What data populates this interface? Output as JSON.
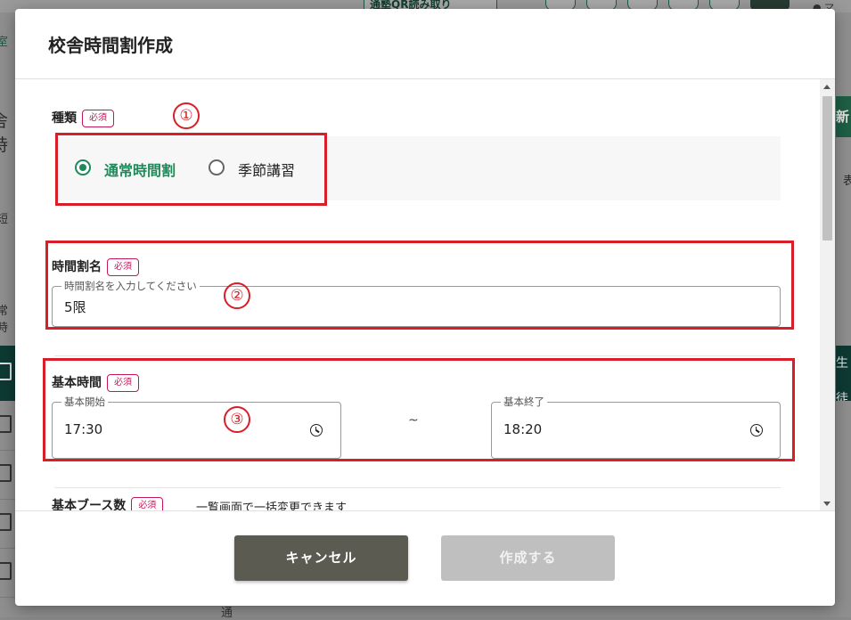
{
  "background": {
    "qr_button_label": "通塾QR読み取り",
    "user_label": "マ",
    "left_edge_texts": [
      "室",
      "舎時",
      "短",
      "常時"
    ],
    "right_edge_texts": [
      "新",
      "表",
      "生徒"
    ],
    "bottom_row_text": "通"
  },
  "modal": {
    "title": "校舎時間割作成",
    "required_label": "必須",
    "type_field": {
      "label": "種類",
      "options": [
        "通常時間割",
        "季節講習"
      ],
      "selected": "通常時間割"
    },
    "name_field": {
      "label": "時間割名",
      "placeholder": "時間割名を入力してください",
      "value": "5限"
    },
    "time_field": {
      "label": "基本時間",
      "start_label": "基本開始",
      "start_value": "17:30",
      "separator": "~",
      "end_label": "基本終了",
      "end_value": "18:20"
    },
    "booth_field": {
      "label": "基本ブース数",
      "note": "一覧画面で一括変更できます"
    },
    "buttons": {
      "cancel": "キャンセル",
      "create": "作成する"
    }
  },
  "annotations": {
    "numbers": [
      "①",
      "②",
      "③"
    ],
    "color": "#d81e28"
  },
  "colors": {
    "accent_green": "#1e8a5a",
    "required_pink": "#c2185b",
    "cancel_button": "#5b5b52",
    "create_button_disabled": "#bfbfbf"
  }
}
